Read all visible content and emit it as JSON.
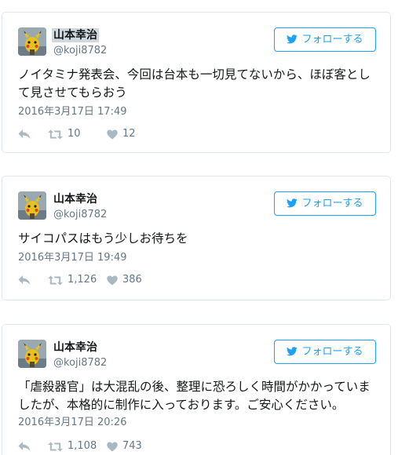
{
  "tweets": [
    {
      "user": {
        "name": "山本幸治",
        "handle": "@koji8782"
      },
      "follow_label": "フォローする",
      "text": "ノイタミナ発表会、今回は台本も一切見てないから、ほぼ客として見させてもらおう",
      "timestamp": "2016年3月17日 17:49",
      "retweets": "10",
      "likes": "12"
    },
    {
      "user": {
        "name": "山本幸治",
        "handle": "@koji8782"
      },
      "follow_label": "フォローする",
      "text": "サイコパスはもう少しお待ちを",
      "timestamp": "2016年3月17日 19:49",
      "retweets": "1,126",
      "likes": "386"
    },
    {
      "user": {
        "name": "山本幸治",
        "handle": "@koji8782"
      },
      "follow_label": "フォローする",
      "text": "「虐殺器官」は大混乱の後、整理に恐ろしく時間がかかっていましたが、本格的に制作に入っております。ご安心ください。",
      "timestamp": "2016年3月17日 20:26",
      "retweets": "1,108",
      "likes": "743"
    }
  ],
  "colors": {
    "accent": "#1da1f2",
    "border": "#e1e8ed",
    "secondary_text": "#657786",
    "icon": "#aab8c2"
  },
  "icons": [
    "avatar",
    "twitter-bird-icon",
    "reply-icon",
    "retweet-icon",
    "heart-icon"
  ]
}
